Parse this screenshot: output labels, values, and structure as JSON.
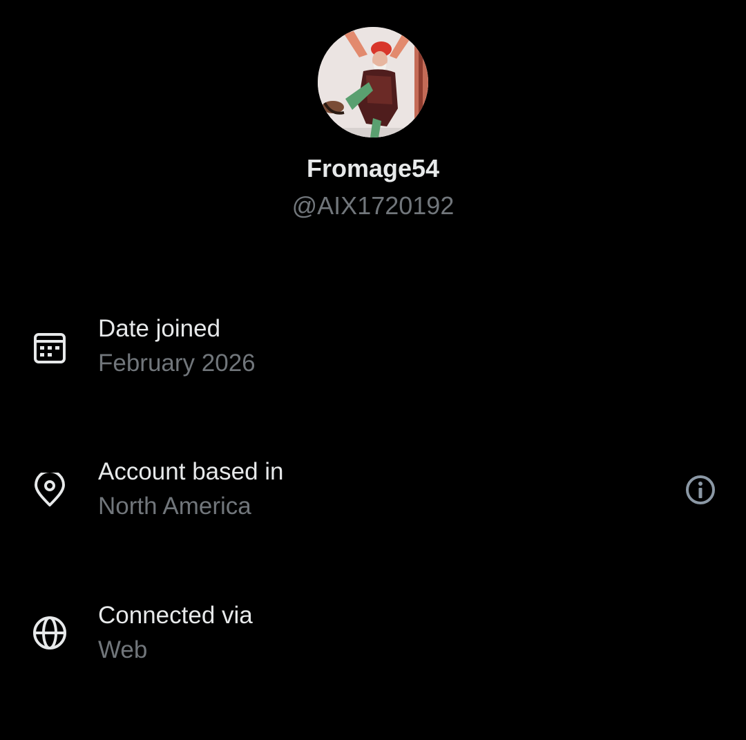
{
  "profile": {
    "display_name": "Fromage54",
    "handle": "@AIX1720192",
    "avatar_icon": "jester-illustration-avatar"
  },
  "rows": [
    {
      "label": "Date joined",
      "value": "February 2026",
      "icon": "calendar-icon"
    },
    {
      "label": "Account based in",
      "value": "North America",
      "icon": "location-pin-icon",
      "trailing_icon": "info-icon"
    },
    {
      "label": "Connected via",
      "value": "Web",
      "icon": "globe-icon"
    }
  ],
  "colors": {
    "background": "#000000",
    "primary_text": "#e7e9ea",
    "secondary_text": "#71767b",
    "info_icon": "#8b98a5"
  }
}
